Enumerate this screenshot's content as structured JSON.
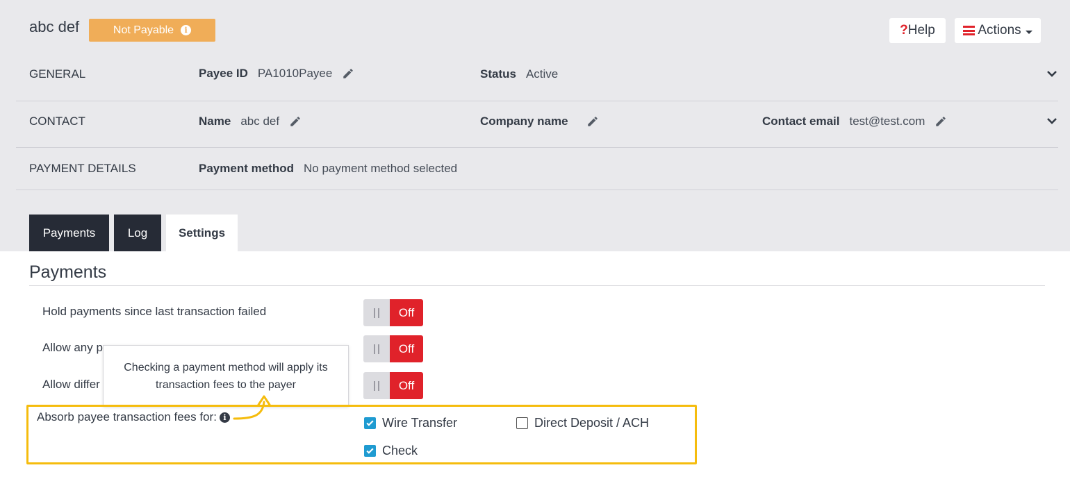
{
  "header": {
    "payee_name": "abc def",
    "status_badge": "Not Payable",
    "help_label": "Help",
    "actions_label": "Actions"
  },
  "general": {
    "label": "GENERAL",
    "payee_id_label": "Payee ID",
    "payee_id_value": "PA1010Payee",
    "status_label": "Status",
    "status_value": "Active"
  },
  "contact": {
    "label": "CONTACT",
    "name_label": "Name",
    "name_value": "abc def",
    "company_label": "Company name",
    "company_value": "",
    "email_label": "Contact email",
    "email_value": "test@test.com"
  },
  "payment_details": {
    "label": "PAYMENT DETAILS",
    "method_label": "Payment method",
    "method_value": "No payment method selected"
  },
  "tabs": [
    {
      "label": "Payments",
      "active": false
    },
    {
      "label": "Log",
      "active": false
    },
    {
      "label": "Settings",
      "active": true
    }
  ],
  "settings": {
    "section_title": "Payments",
    "options": [
      {
        "label": "Hold payments since last transaction failed",
        "state": "Off"
      },
      {
        "label": "Allow any p",
        "state": "Off"
      },
      {
        "label": "Allow differ",
        "state": "Off"
      }
    ],
    "tooltip": "Checking a payment method will apply its transaction fees to the payer",
    "absorb_label": "Absorb payee transaction fees for:",
    "methods": [
      {
        "label": "Wire Transfer",
        "checked": true
      },
      {
        "label": "Direct Deposit / ACH",
        "checked": false
      },
      {
        "label": "Check",
        "checked": true
      }
    ]
  },
  "colors": {
    "badge": "#f0ad58",
    "toggle_off": "#e0222a",
    "checkbox": "#1f9bd1",
    "highlight": "#f5bc0d",
    "tab_dark": "#262b36"
  }
}
